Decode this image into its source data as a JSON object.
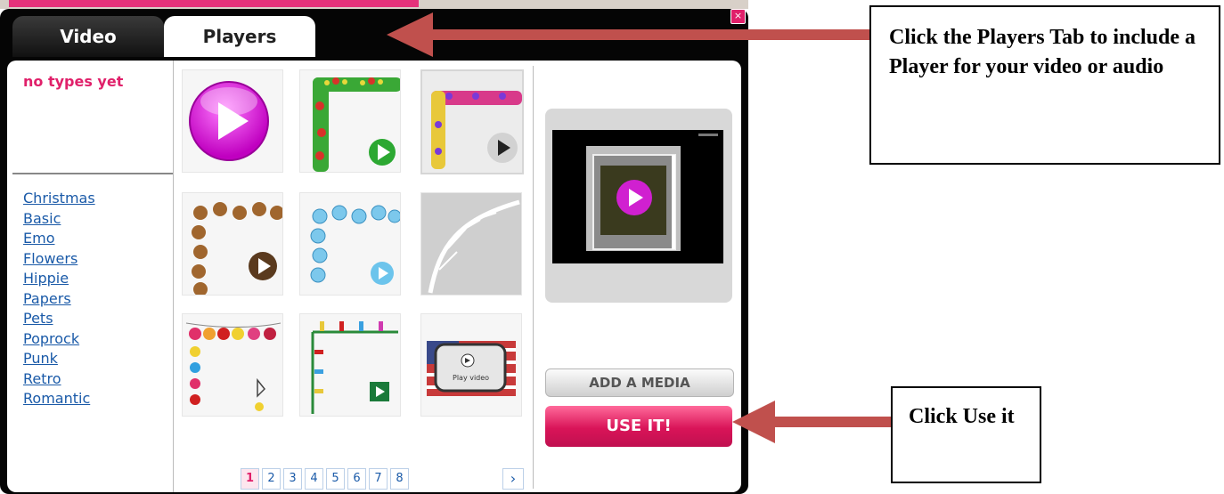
{
  "window": {
    "close_glyph": "×",
    "tabs": [
      {
        "label": "Video",
        "active": false
      },
      {
        "label": "Players",
        "active": true
      }
    ]
  },
  "categories": {
    "empty_label": "no types yet",
    "items": [
      "Christmas",
      "Basic",
      "Emo",
      "Flowers",
      "Hippie",
      "Papers",
      "Pets",
      "Poprock",
      "Punk",
      "Retro",
      "Romantic"
    ]
  },
  "thumbnails": [
    {
      "name": "magenta-play-orb",
      "selected": false
    },
    {
      "name": "merry-christmas-green-play",
      "selected": false
    },
    {
      "name": "happy-candy-dark-play",
      "selected": true
    },
    {
      "name": "gingerbread-brown-play",
      "selected": false
    },
    {
      "name": "snowflake-blue-play",
      "selected": false
    },
    {
      "name": "white-pine-branch",
      "selected": false
    },
    {
      "name": "ornament-string-play",
      "selected": false
    },
    {
      "name": "christmas-lights-play",
      "selected": false
    },
    {
      "name": "flag-tv-play-video",
      "selected": false
    }
  ],
  "thumbnail_text": {
    "tv_caption": "Play video"
  },
  "pagination": {
    "pages": [
      "1",
      "2",
      "3",
      "4",
      "5",
      "6",
      "7",
      "8"
    ],
    "current": "1",
    "next_glyph": "›"
  },
  "actions": {
    "add_media_label": "ADD A MEDIA",
    "use_it_label": "USE IT!"
  },
  "callouts": {
    "players_tab": "Click the Players Tab to include a Player for your video or audio",
    "use_it": "Click Use it"
  },
  "colors": {
    "accent_pink": "#e0206a",
    "link_blue": "#1a5aa8",
    "arrow_red": "#c0504d"
  }
}
